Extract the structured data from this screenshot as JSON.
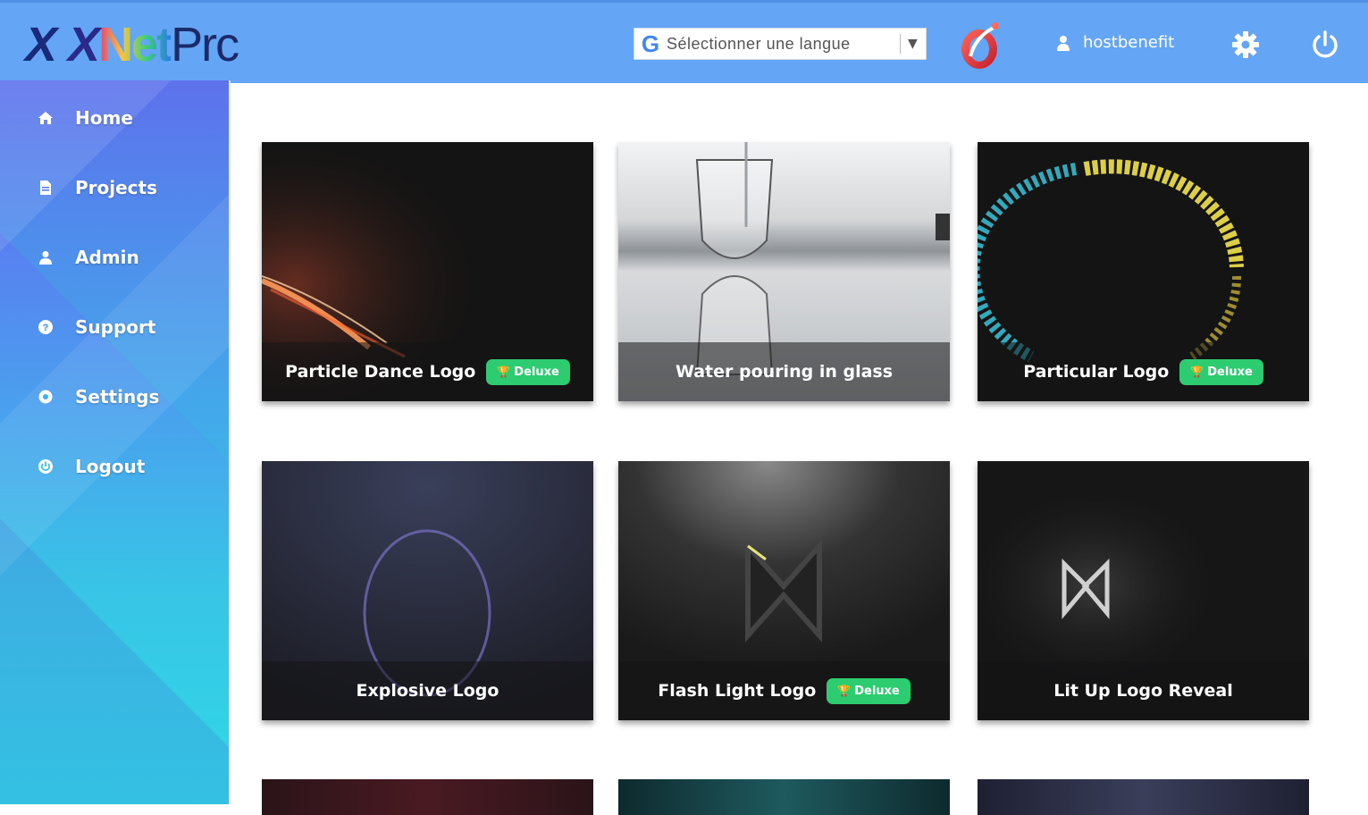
{
  "header": {
    "logo": {
      "z1": "X",
      "z2": "X",
      "net": "Net",
      "pro": "Prc"
    },
    "translate": {
      "g": "G",
      "label": "Sélectionner une langue",
      "caret": "▼"
    },
    "user": {
      "name": "hostbenefit"
    }
  },
  "sidebar": {
    "items": [
      {
        "label": "Home",
        "icon": "home-icon"
      },
      {
        "label": "Projects",
        "icon": "file-icon"
      },
      {
        "label": "Admin",
        "icon": "user-icon"
      },
      {
        "label": "Support",
        "icon": "help-icon"
      },
      {
        "label": "Settings",
        "icon": "gear-icon"
      },
      {
        "label": "Logout",
        "icon": "power-icon"
      }
    ]
  },
  "cards": [
    {
      "title": "Particle Dance Logo",
      "badge": "Deluxe"
    },
    {
      "title": "Water pouring in glass",
      "badge": ""
    },
    {
      "title": "Particular Logo",
      "badge": "Deluxe"
    },
    {
      "title": "Explosive Logo",
      "badge": ""
    },
    {
      "title": "Flash Light Logo",
      "badge": "Deluxe"
    },
    {
      "title": "Lit Up Logo Reveal",
      "badge": ""
    }
  ],
  "colors": {
    "header": "#64a5f5",
    "badge": "#2ecc71"
  }
}
